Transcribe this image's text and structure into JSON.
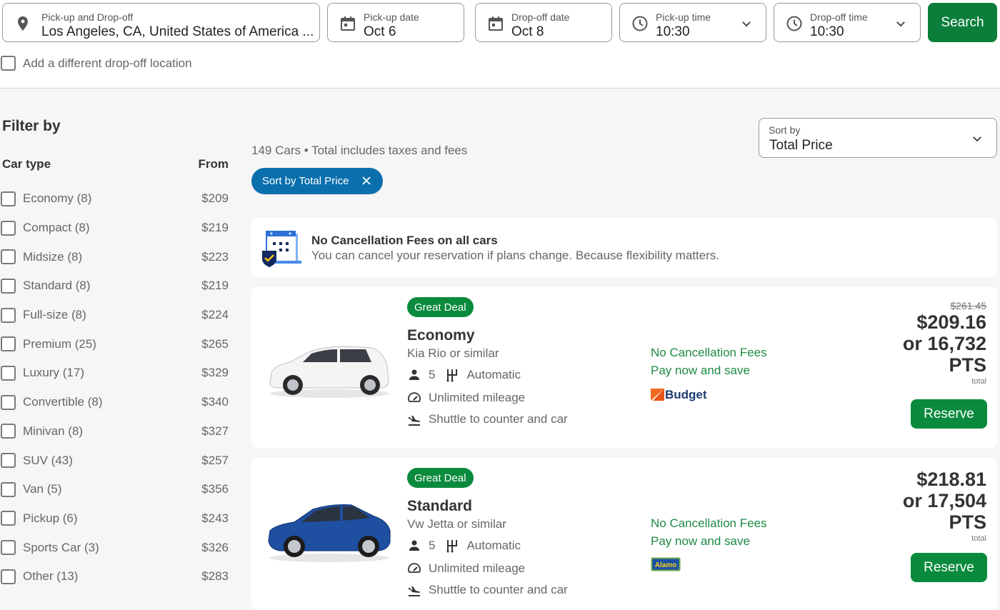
{
  "search": {
    "location": {
      "label": "Pick-up and Drop-off",
      "value": "Los Angeles, CA, United States of America ..."
    },
    "pickup_date": {
      "label": "Pick-up date",
      "value": "Oct 6"
    },
    "dropoff_date": {
      "label": "Drop-off date",
      "value": "Oct 8"
    },
    "pickup_time": {
      "label": "Pick-up time",
      "value": "10:30"
    },
    "dropoff_time": {
      "label": "Drop-off time",
      "value": "10:30"
    },
    "search_label": "Search",
    "different_dropoff_label": "Add a different drop-off location",
    "different_dropoff_checked": false
  },
  "filters": {
    "title": "Filter by",
    "col_type": "Car type",
    "col_from": "From",
    "items": [
      {
        "name": "Economy (8)",
        "price": "$209"
      },
      {
        "name": "Compact (8)",
        "price": "$219"
      },
      {
        "name": "Midsize (8)",
        "price": "$223"
      },
      {
        "name": "Standard (8)",
        "price": "$219"
      },
      {
        "name": "Full-size (8)",
        "price": "$224"
      },
      {
        "name": "Premium (25)",
        "price": "$265"
      },
      {
        "name": "Luxury (17)",
        "price": "$329"
      },
      {
        "name": "Convertible (8)",
        "price": "$340"
      },
      {
        "name": "Minivan (8)",
        "price": "$327"
      },
      {
        "name": "SUV (43)",
        "price": "$257"
      },
      {
        "name": "Van (5)",
        "price": "$356"
      },
      {
        "name": "Pickup (6)",
        "price": "$243"
      },
      {
        "name": "Sports Car (3)",
        "price": "$326"
      },
      {
        "name": "Other (13)",
        "price": "$283"
      }
    ]
  },
  "results": {
    "summary": "149 Cars • Total includes taxes and fees",
    "active_chip": "Sort by Total Price",
    "sort": {
      "label": "Sort by",
      "value": "Total Price"
    }
  },
  "banner": {
    "title": "No Cancellation Fees on all cars",
    "text": "You can cancel your reservation if plans change. Because flexibility matters."
  },
  "cars": [
    {
      "badge": "Great Deal",
      "class": "Economy",
      "model": "Kia Rio or similar",
      "seats": "5",
      "transmission": "Automatic",
      "mileage": "Unlimited mileage",
      "shuttle": "Shuttle to counter and car",
      "perk_1": "No Cancellation Fees",
      "perk_2": "Pay now and save",
      "vendor": "Budget",
      "old_price": "$261.45",
      "price": "$209.16",
      "points": "or 16,732",
      "points_unit": "PTS",
      "total_label": "total",
      "reserve_label": "Reserve",
      "color": "#f2f2f2"
    },
    {
      "badge": "Great Deal",
      "class": "Standard",
      "model": "Vw Jetta or similar",
      "seats": "5",
      "transmission": "Automatic",
      "mileage": "Unlimited mileage",
      "shuttle": "Shuttle to counter and car",
      "perk_1": "No Cancellation Fees",
      "perk_2": "Pay now and save",
      "vendor": "Alamo",
      "price": "$218.81",
      "points": "or 17,504",
      "points_unit": "PTS",
      "total_label": "total",
      "reserve_label": "Reserve",
      "color": "#1e4fa0"
    }
  ],
  "colors": {
    "primary_green": "#0a7e3a",
    "badge_green": "#0a8a3c",
    "perk_green": "#1e8a44",
    "chip_blue": "#0a6fad"
  }
}
